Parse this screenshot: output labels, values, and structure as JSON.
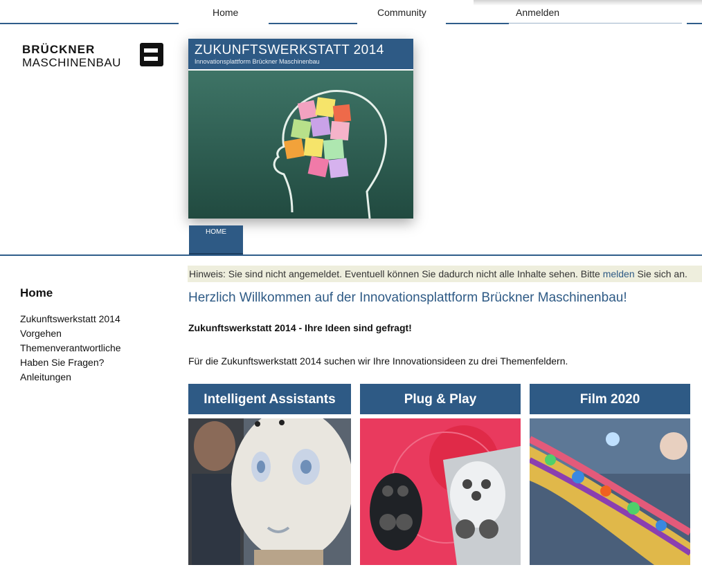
{
  "nav": {
    "items": [
      {
        "label": "Home"
      },
      {
        "label": "Community"
      },
      {
        "label": "Anmelden"
      }
    ]
  },
  "logo": {
    "line1": "BRÜCKNER",
    "line2": "MASCHINENBAU"
  },
  "banner": {
    "title": "ZUKUNFTSWERKSTATT 2014",
    "subtitle": "Innovationsplattform Brückner Maschinenbau"
  },
  "home_tab": "HOME",
  "sidebar": {
    "title": "Home",
    "items": [
      "Zukunftswerkstatt 2014",
      "Vorgehen",
      "Themenverantwortliche",
      "Haben Sie Fragen?",
      "Anleitungen"
    ]
  },
  "notice": {
    "before": "Hinweis: Sie sind nicht angemeldet. Eventuell können Sie dadurch nicht alle Inhalte sehen. Bitte ",
    "link": "melden",
    "after": " Sie sich an."
  },
  "main": {
    "welcome": "Herzlich Willkommen auf der Innovationsplattform Brückner Maschinenbau!",
    "subhead": "Zukunftswerkstatt 2014 - Ihre Ideen sind gefragt!",
    "intro": "Für die Zukunftswerkstatt 2014 suchen wir Ihre Innovationsideen zu drei Themenfeldern."
  },
  "cards": [
    {
      "title": "Intelligent Assistants"
    },
    {
      "title": "Plug & Play"
    },
    {
      "title": "Film 2020"
    }
  ],
  "colors": {
    "accent": "#2e5a85",
    "notice_bg": "#eeeedd"
  }
}
